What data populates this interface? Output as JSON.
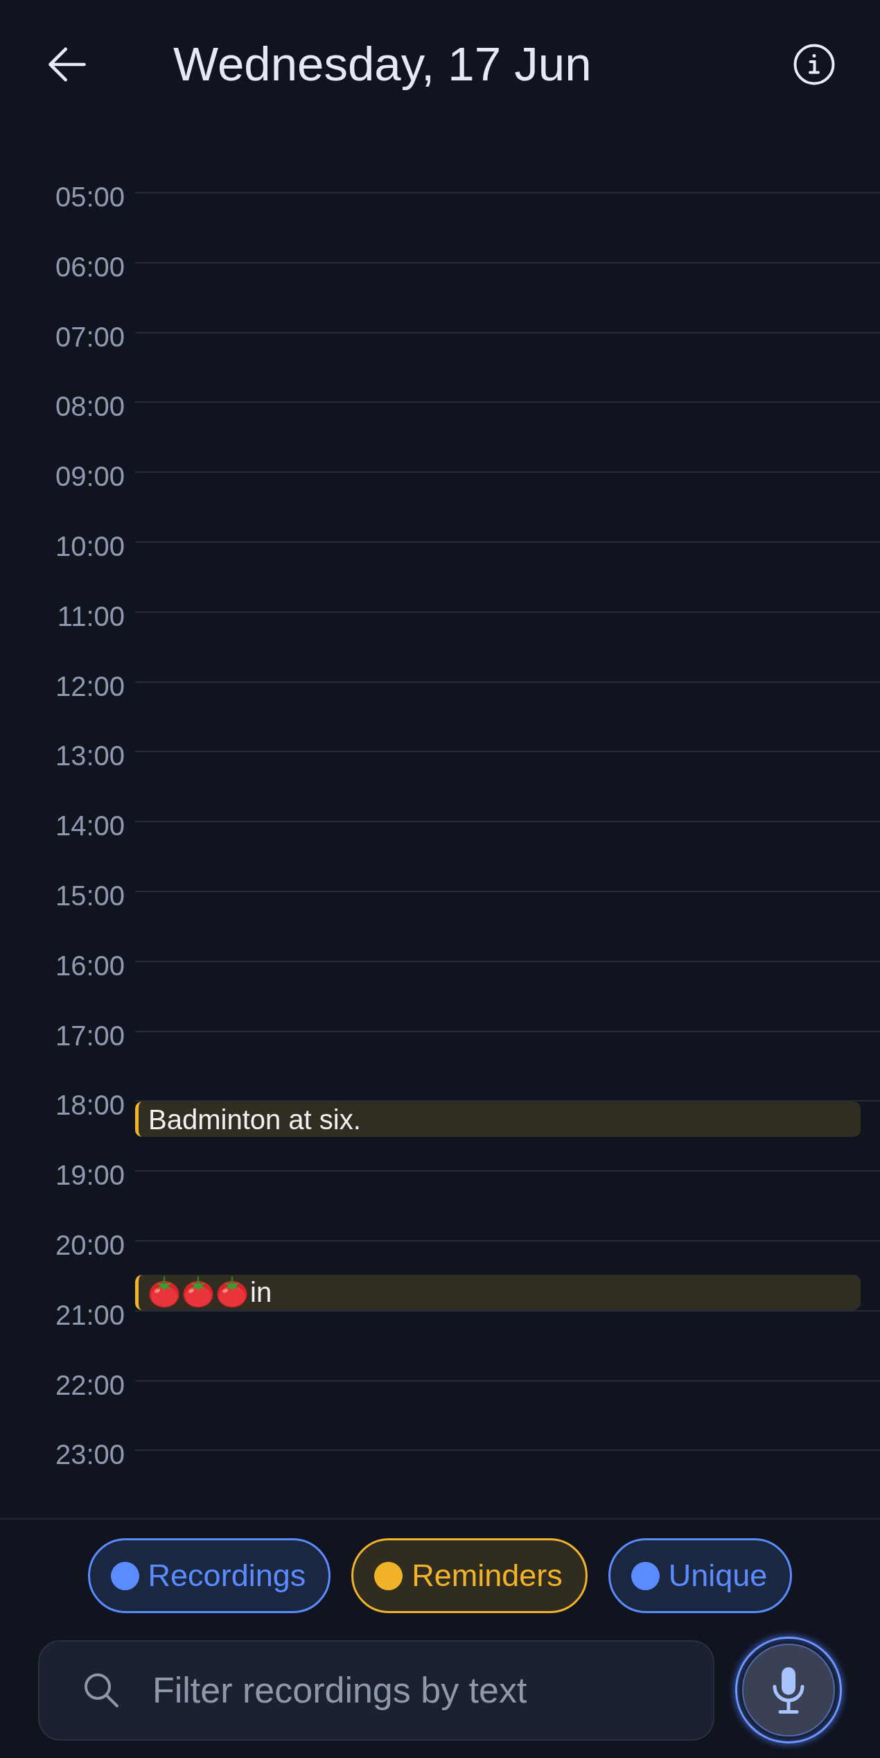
{
  "header": {
    "title": "Wednesday, 17 Jun"
  },
  "hours": [
    {
      "label": "05:00"
    },
    {
      "label": "06:00"
    },
    {
      "label": "07:00"
    },
    {
      "label": "08:00"
    },
    {
      "label": "09:00"
    },
    {
      "label": "10:00"
    },
    {
      "label": "11:00"
    },
    {
      "label": "12:00"
    },
    {
      "label": "13:00"
    },
    {
      "label": "14:00"
    },
    {
      "label": "15:00"
    },
    {
      "label": "16:00"
    },
    {
      "label": "17:00"
    },
    {
      "label": "18:00",
      "events": [
        {
          "half_past": false,
          "title": "Badminton at six."
        }
      ]
    },
    {
      "label": "19:00"
    },
    {
      "label": "20:00",
      "events": [
        {
          "half_past": true,
          "icons": [
            {
              "kind": "tomato"
            },
            {
              "kind": "tomato"
            },
            {
              "kind": "tomato"
            }
          ],
          "title": "in"
        }
      ]
    },
    {
      "label": "21:00"
    },
    {
      "label": "22:00"
    },
    {
      "label": "23:00"
    }
  ],
  "filter_chips": [
    {
      "label": "Recordings",
      "color": "#5b8cff",
      "selected": true
    },
    {
      "label": "Reminders",
      "color": "#f0b32a",
      "selected": true
    },
    {
      "label": "Unique",
      "color": "#5b8cff",
      "selected": true
    }
  ],
  "search": {
    "placeholder": "Filter recordings by text"
  }
}
